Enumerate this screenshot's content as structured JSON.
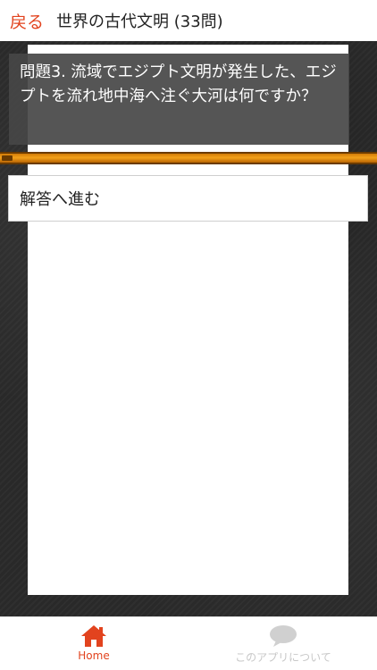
{
  "header": {
    "back_label": "戻る",
    "title": "世界の古代文明 (33問)"
  },
  "question": {
    "text": "問題3. 流域でエジプト文明が発生した、エジプトを流れ地中海へ注ぐ大河は何ですか？"
  },
  "answer_button": {
    "label": "解答へ進む"
  },
  "bottom_nav": {
    "items": [
      {
        "label": "Home",
        "icon": "home-icon",
        "active": true
      },
      {
        "label": "このアプリについて",
        "icon": "speech-bubble-icon",
        "active": false
      }
    ]
  },
  "colors": {
    "accent": "#e2431e",
    "progress": "#f3a21a",
    "question_bg": "#464646",
    "inactive": "#c8c8c8"
  }
}
